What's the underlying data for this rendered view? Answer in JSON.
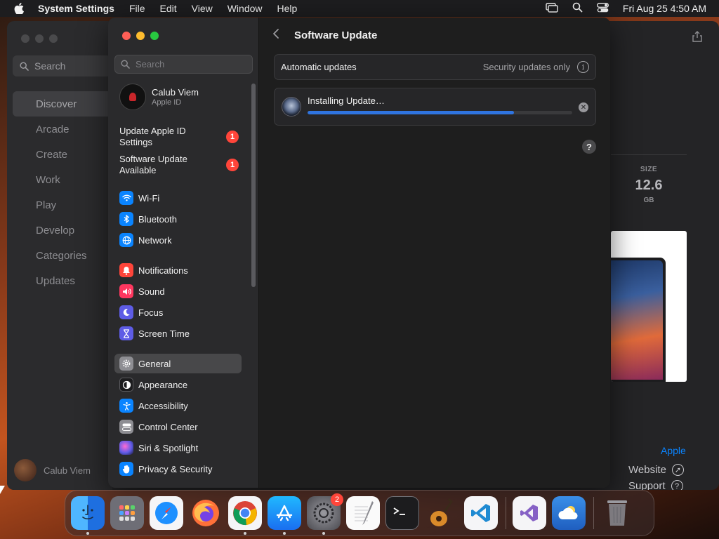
{
  "menubar": {
    "app_name": "System Settings",
    "menus": [
      "File",
      "Edit",
      "View",
      "Window",
      "Help"
    ],
    "clock": "Fri Aug 25  4:50 AM"
  },
  "appstore": {
    "search_placeholder": "Search",
    "nav": [
      "Discover",
      "Arcade",
      "Create",
      "Work",
      "Play",
      "Develop",
      "Categories",
      "Updates"
    ],
    "active_nav": "Discover",
    "user_name": "Calub Viem",
    "size_label": "SIZE",
    "size_value": "12.6",
    "size_unit": "GB",
    "developer_link": "Apple",
    "website_label": "Website",
    "support_label": "Support"
  },
  "settings": {
    "search_placeholder": "Search",
    "account": {
      "name": "Calub Viem",
      "subtitle": "Apple ID"
    },
    "alerts": [
      {
        "label": "Update Apple ID Settings",
        "badge": "1"
      },
      {
        "label": "Software Update Available",
        "badge": "1"
      }
    ],
    "sidebar": [
      {
        "label": "Wi-Fi",
        "icon": "wifi-icon",
        "color": "#0a84ff"
      },
      {
        "label": "Bluetooth",
        "icon": "bluetooth-icon",
        "color": "#0a84ff"
      },
      {
        "label": "Network",
        "icon": "globe-icon",
        "color": "#0a84ff"
      },
      {
        "label": "Notifications",
        "icon": "bell-icon",
        "color": "#ff453a"
      },
      {
        "label": "Sound",
        "icon": "speaker-icon",
        "color": "#ff375f"
      },
      {
        "label": "Focus",
        "icon": "moon-icon",
        "color": "#5e5ce6"
      },
      {
        "label": "Screen Time",
        "icon": "hourglass-icon",
        "color": "#5e5ce6"
      },
      {
        "label": "General",
        "icon": "gear-icon",
        "color": "#8e8e93"
      },
      {
        "label": "Appearance",
        "icon": "appearance-icon",
        "color": "#1c1c1e"
      },
      {
        "label": "Accessibility",
        "icon": "accessibility-icon",
        "color": "#0a84ff"
      },
      {
        "label": "Control Center",
        "icon": "control-center-icon",
        "color": "#8e8e93"
      },
      {
        "label": "Siri & Spotlight",
        "icon": "siri-icon",
        "color": "#bf5af2"
      },
      {
        "label": "Privacy & Security",
        "icon": "hand-icon",
        "color": "#0a84ff"
      }
    ],
    "active_item": "General",
    "page_title": "Software Update",
    "automatic_updates": {
      "label": "Automatic updates",
      "value": "Security updates only"
    },
    "install": {
      "status": "Installing Update…",
      "progress": 0.78
    }
  },
  "dock": {
    "items": [
      {
        "name": "Finder",
        "icon": "finder-icon",
        "color": "#2a8cf0",
        "running": true
      },
      {
        "name": "Launchpad",
        "icon": "launchpad-icon",
        "color": "#8a8a90",
        "running": false
      },
      {
        "name": "Safari",
        "icon": "safari-icon",
        "color": "#1e90ff",
        "running": false
      },
      {
        "name": "Firefox",
        "icon": "firefox-icon",
        "color": "#ff7139",
        "running": false
      },
      {
        "name": "Chrome",
        "icon": "chrome-icon",
        "color": "#ffffff",
        "running": true
      },
      {
        "name": "App Store",
        "icon": "app-store-icon",
        "color": "#1a8cff",
        "running": true
      },
      {
        "name": "System Settings",
        "icon": "system-settings-icon",
        "color": "#6e6e73",
        "running": true,
        "badge": "2"
      },
      {
        "name": "TextEdit",
        "icon": "textedit-icon",
        "color": "#f5f5f5",
        "running": false
      },
      {
        "name": "Terminal",
        "icon": "terminal-icon",
        "color": "#1c1c1e",
        "running": false
      },
      {
        "name": "GarageBand",
        "icon": "garageband-icon",
        "color": "#3a2a1a",
        "running": false
      },
      {
        "name": "Visual Studio Code",
        "icon": "vscode-icon",
        "color": "#ffffff",
        "running": false
      }
    ],
    "recent": [
      {
        "name": "Visual Studio",
        "icon": "visual-studio-icon",
        "color": "#ffffff"
      },
      {
        "name": "Weather",
        "icon": "weather-icon",
        "color": "#2f7be0"
      }
    ],
    "trash": {
      "name": "Trash",
      "icon": "trash-icon"
    }
  }
}
